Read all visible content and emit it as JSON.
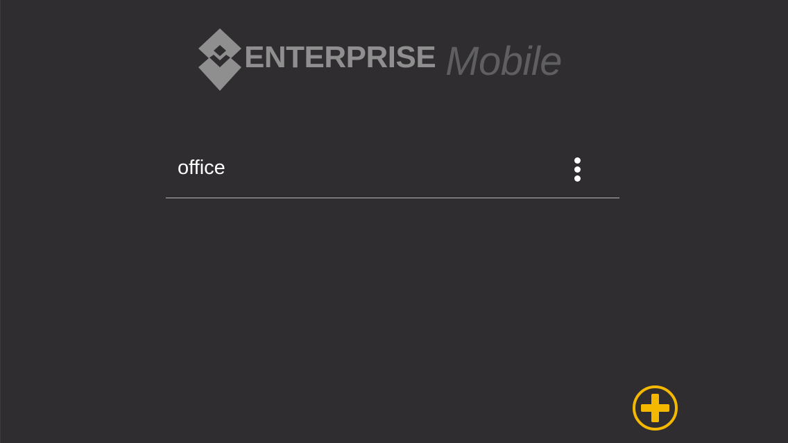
{
  "logo": {
    "word_bold": "ENTERPRISE",
    "word_light": "Mobile",
    "icon": "diamond-logo-icon"
  },
  "profiles": [
    {
      "name": "office",
      "menu_icon": "more-vertical-icon"
    }
  ],
  "add_button": {
    "icon": "plus-circle-icon"
  },
  "colors": {
    "background": "#2f2d2f",
    "accent": "#f5b800",
    "logo_gray": "#8f8f8f",
    "logo_dark_gray": "#5f5e60",
    "divider": "#b9b8b9"
  }
}
